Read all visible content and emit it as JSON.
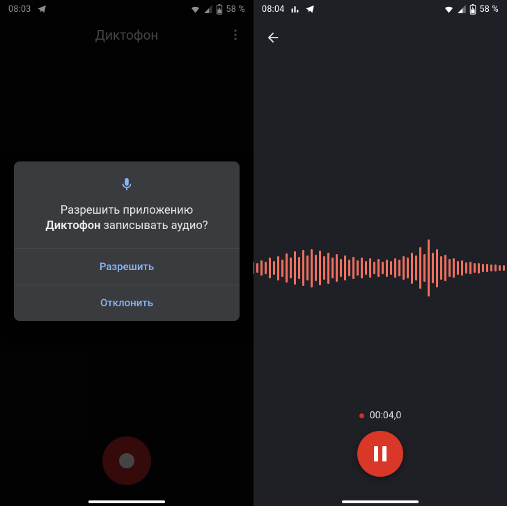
{
  "left": {
    "status": {
      "time": "08:03",
      "battery": "58 %"
    },
    "header": {
      "title": "Диктофон"
    },
    "dialog": {
      "line1": "Разрешить приложению",
      "app_bold": "Диктофон",
      "line2_tail": " записывать аудио?",
      "allow": "Разрешить",
      "deny": "Отклонить"
    }
  },
  "right": {
    "status": {
      "time": "08:04",
      "battery": "58 %"
    },
    "timer": "00:04,0",
    "waveform_heights": [
      4,
      5,
      3,
      6,
      8,
      7,
      12,
      10,
      18,
      14,
      22,
      18,
      30,
      20,
      35,
      25,
      42,
      30,
      48,
      32,
      52,
      36,
      55,
      38,
      50,
      34,
      45,
      30,
      40,
      26,
      36,
      24,
      32,
      22,
      30,
      20,
      28,
      18,
      26,
      18,
      25,
      20,
      28,
      24,
      34,
      30,
      45,
      36,
      60,
      40,
      82,
      44,
      55,
      34,
      38,
      26,
      28,
      20,
      22,
      16,
      18,
      14,
      15,
      12,
      12,
      10,
      10,
      8,
      8,
      7,
      7,
      6,
      6,
      5,
      5,
      4,
      4,
      4
    ]
  },
  "icons": {
    "telegram": "telegram-icon",
    "wifi": "wifi-icon",
    "signal": "signal-icon",
    "battery": "battery-icon",
    "more": "more-vert-icon",
    "mic": "mic-icon",
    "back": "back-arrow-icon",
    "eq": "equalizer-icon"
  }
}
